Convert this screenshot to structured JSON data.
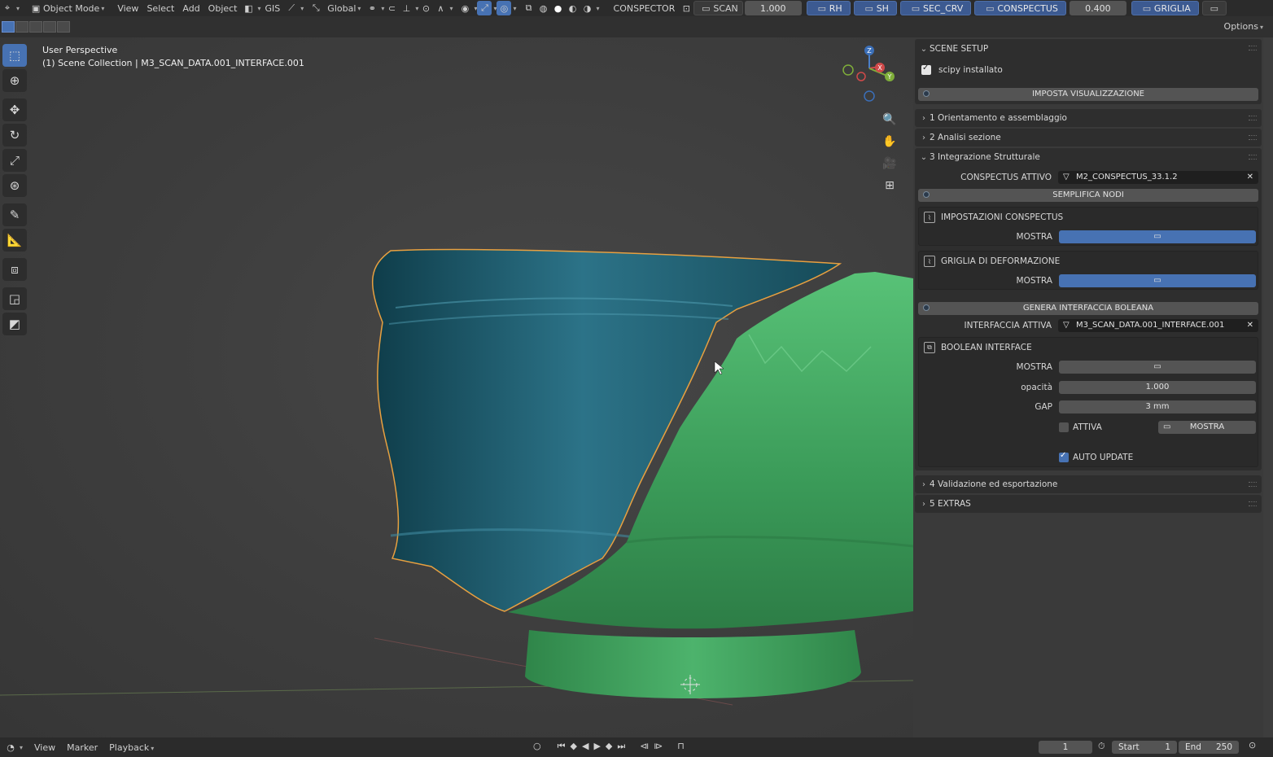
{
  "header": {
    "editor_type_icon": "view3d-icon",
    "mode_label": "Object Mode",
    "menus": [
      "View",
      "Select",
      "Add",
      "Object"
    ],
    "gis_label": "GIS",
    "orientation_label": "Global",
    "conspector_label": "CONSPECTOR",
    "scan_label": "SCAN",
    "scan_value": "1.000",
    "rh_label": "RH",
    "sh_label": "SH",
    "sec_crv_label": "SEC_CRV",
    "conspectus_label": "CONSPECTUS",
    "conspectus_value": "0.400",
    "griglia_label": "GRIGLIA"
  },
  "subheader": {
    "options_label": "Options"
  },
  "viewport": {
    "perspective_label": "User Perspective",
    "collection_label": "(1) Scene Collection | M3_SCAN_DATA.001_INTERFACE.001",
    "gizmo": {
      "x_label": "X",
      "y_label": "Y",
      "z_label": "Z"
    }
  },
  "panel": {
    "scene_setup_title": "SCENE SETUP",
    "scipy_label": "scipy installato",
    "imposta_button": "IMPOSTA VISUALIZZAZIONE",
    "section1": "1 Orientamento e assemblaggio",
    "section2": "2 Analisi sezione",
    "section3": "3 Integrazione Strutturale",
    "conspectus_attivo_label": "CONSPECTUS ATTIVO",
    "conspectus_attivo_value": "M2_CONSPECTUS_33.1.2",
    "semplifica_button": "SEMPLIFICA NODI",
    "impostazioni_title": "IMPOSTAZIONI CONSPECTUS",
    "mostra_label": "MOSTRA",
    "griglia_title": "GRIGLIA DI DEFORMAZIONE",
    "genera_button": "GENERA INTERFACCIA BOLEANA",
    "interfaccia_label": "INTERFACCIA ATTIVA",
    "interfaccia_value": "M3_SCAN_DATA.001_INTERFACE.001",
    "boolean_title": "BOOLEAN INTERFACE",
    "opacita_label": "opacità",
    "opacita_value": "1.000",
    "gap_label": "GAP",
    "gap_value": "3 mm",
    "attiva_label": "ATTIVA",
    "mostra_btn_label": "MOSTRA",
    "auto_update_label": "AUTO UPDATE",
    "section4": "4 Validazione ed esportazione",
    "section5": "5 EXTRAS"
  },
  "timeline": {
    "menus": [
      "View",
      "Marker",
      "Playback"
    ],
    "current_frame": "1",
    "start_label": "Start",
    "start_value": "1",
    "end_label": "End",
    "end_value": "250"
  },
  "colors": {
    "accent": "#4772b3",
    "teal_mesh": "#1d5a6b",
    "green_mesh": "#3fa35f",
    "selection_outline": "#e8a040"
  }
}
